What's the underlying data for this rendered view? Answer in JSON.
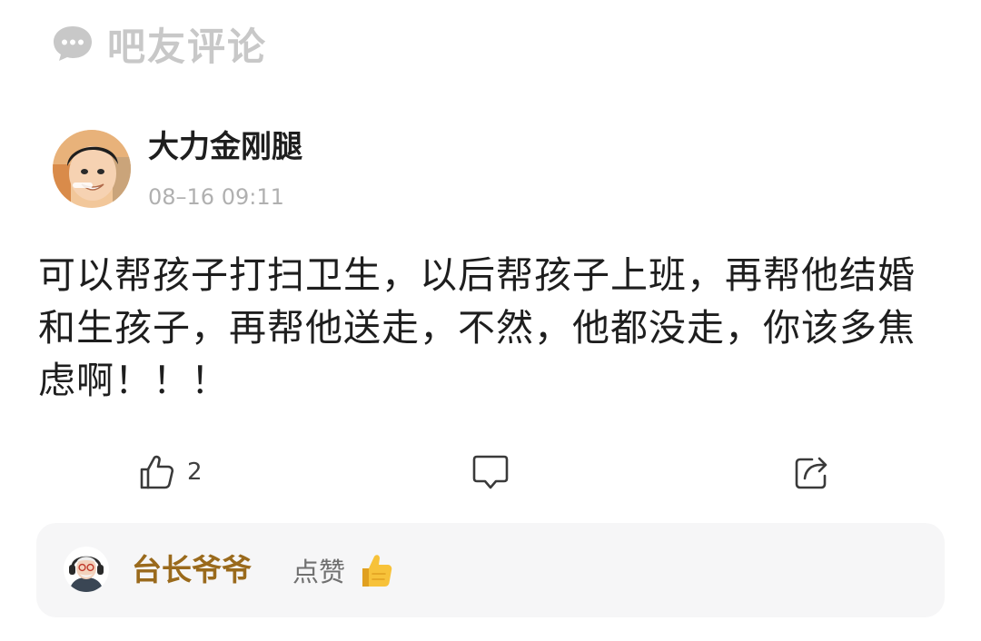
{
  "header": {
    "icon": "chat-bubble-icon",
    "title": "吧友评论"
  },
  "comment": {
    "author": "大力金刚腿",
    "timestamp": "08–16 09:11",
    "text": "可以帮孩子打扫卫生，以后帮孩子上班，再帮他结婚和生孩子，再帮他送走，不然，他都没走，你该多焦虑啊！！！",
    "actions": {
      "like_icon": "thumbs-up-icon",
      "like_count": "2",
      "reply_icon": "reply-bubble-icon",
      "share_icon": "share-icon"
    }
  },
  "likes": {
    "user": "台长爷爷",
    "action_text": "点赞",
    "emoji": "thumbs-up-emoji"
  },
  "colors": {
    "header_text": "#c8c8c8",
    "body_text": "#1e1e1e",
    "timestamp": "#b0b0b0",
    "liker_name": "#9a6a1c",
    "like_row_bg": "#f6f6f7"
  }
}
